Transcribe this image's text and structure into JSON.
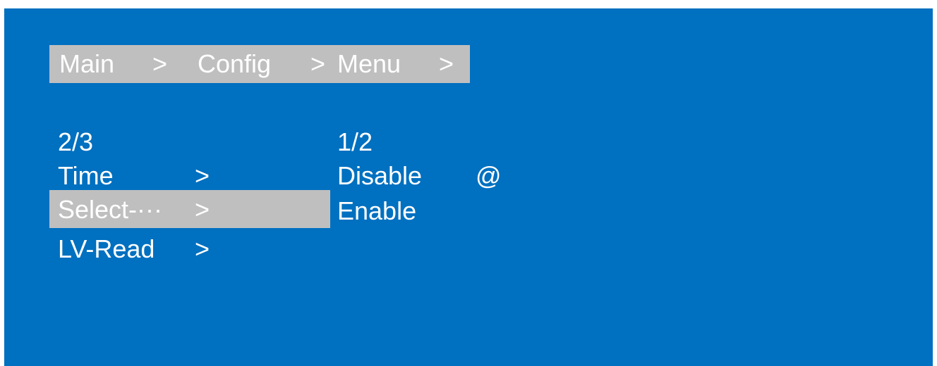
{
  "breadcrumb": {
    "items": [
      "Main",
      ">",
      "Config",
      ">",
      "Menu",
      ">"
    ]
  },
  "left_menu": {
    "page": "2/3",
    "items": [
      {
        "label": "Time",
        "arrow": ">"
      },
      {
        "label": "Select-···",
        "arrow": ">",
        "selected": true
      },
      {
        "label": "LV-Read",
        "arrow": ">"
      }
    ]
  },
  "right_menu": {
    "page": "1/2",
    "items": [
      {
        "label": "Disable",
        "marker": "@"
      },
      {
        "label": "Enable",
        "marker": ""
      }
    ]
  },
  "colors": {
    "background": "#0070c0",
    "highlight": "#bfbfbf",
    "text": "#ffffff"
  }
}
